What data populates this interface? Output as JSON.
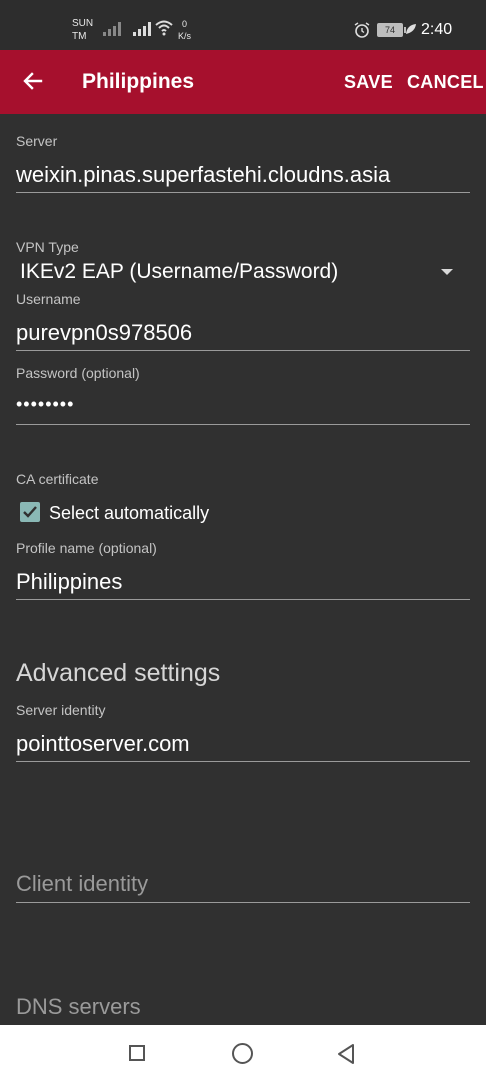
{
  "status_bar": {
    "carrier_line1": "SUN",
    "carrier_line2": "TM",
    "net_speed_value": "0",
    "net_speed_unit": "K/s",
    "battery": "74",
    "time": "2:40",
    "icons": [
      "signal-icon",
      "signal-icon",
      "wifi-icon",
      "alarm-icon",
      "battery-icon",
      "leaf-icon"
    ]
  },
  "app_bar": {
    "title": "Philippines",
    "save_label": "SAVE",
    "cancel_label": "CANCEL"
  },
  "form": {
    "server_label": "Server",
    "server_value": "weixin.pinas.superfastehi.cloudns.asia",
    "vpn_type_label": "VPN Type",
    "vpn_type_value": "IKEv2 EAP (Username/Password)",
    "username_label": "Username",
    "username_value": "purevpn0s978506",
    "password_label": "Password (optional)",
    "password_value": "••••••••",
    "ca_cert_label": "CA certificate",
    "ca_auto_label": "Select automatically",
    "ca_auto_checked": true,
    "profile_label": "Profile name (optional)",
    "profile_value": "Philippines"
  },
  "advanced": {
    "heading": "Advanced settings",
    "server_identity_label": "Server identity",
    "server_identity_value": "pointtoserver.com",
    "client_identity_hint": "Client identity",
    "dns_servers_hint": "DNS servers"
  },
  "colors": {
    "app_bar": "#a6102d",
    "background": "#303030",
    "checkbox": "#8ab8b5"
  }
}
